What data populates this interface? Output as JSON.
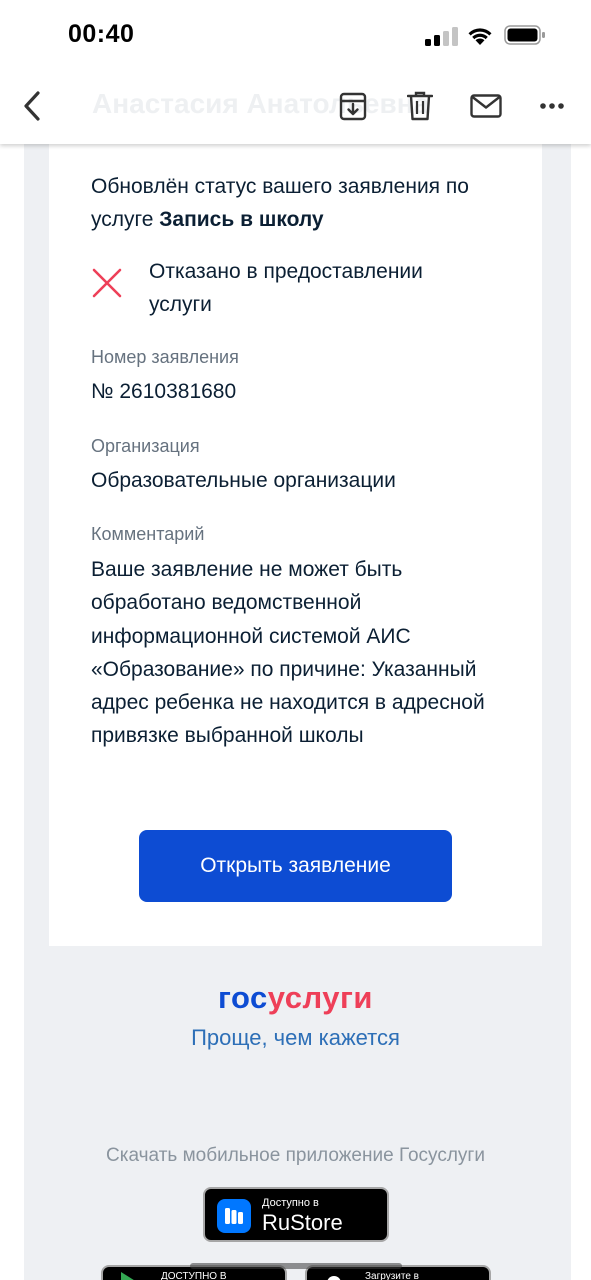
{
  "status_bar": {
    "time": "00:40"
  },
  "toolbar": {
    "sender": "Анастасия Анатольевна",
    "icons": [
      "chevron-left-icon",
      "archive-icon",
      "trash-icon",
      "mail-icon",
      "more-icon"
    ]
  },
  "email": {
    "intro_text": "Обновлён статус вашего заявления по услуге ",
    "service_name": "Запись в школу",
    "status_text": "Отказано в предоставлении услуги",
    "number_label": "Номер заявления",
    "number_value": "№ 2610381680",
    "org_label": "Организация",
    "org_value": "Образовательные организации",
    "comment_label": "Комментарий",
    "comment_value": "Ваше заявление не может быть обработано ведомственной информационной системой АИС «Образование» по причине: Указанный адрес ребенка не находится в адресной привязке выбранной школы",
    "button_label": "Открыть заявление"
  },
  "footer": {
    "logo_part1": "гос",
    "logo_part2": "услуги",
    "slogan": "Проще, чем кажется",
    "download_text": "Скачать мобильное приложение Госуслуги",
    "rustore_small": "Доступно в",
    "rustore_big": "RuStore",
    "gplay_small": "ДОСТУПНО В",
    "appstore_small": "Загрузите в"
  },
  "colors": {
    "primary": "#0d4cd3",
    "logo_red": "#ee3f58",
    "reject": "#ee3f58",
    "text": "#0b1f33",
    "muted": "#66727f"
  }
}
